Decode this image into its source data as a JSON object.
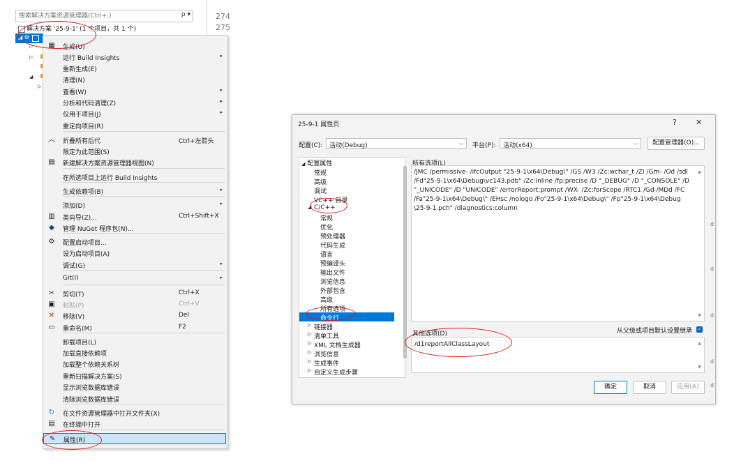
{
  "solution_explorer": {
    "search_placeholder": "搜索解决方案资源管理器(Ctrl+;)",
    "search_button": "ρ ▾",
    "solution_node": "解决方案 '25-9-1' (1 个项目，共 1 个)",
    "project_node": "25-9-1",
    "background_texts": [
      "274",
      "275"
    ]
  },
  "context_menu": {
    "items": [
      {
        "label": "生成(U)",
        "icon": "build-icon",
        "shortcut": "",
        "submenu": false,
        "disabled": false
      },
      {
        "label": "运行 Build Insights",
        "icon": "",
        "shortcut": "",
        "submenu": true,
        "disabled": false
      },
      {
        "label": "重新生成(E)",
        "icon": "",
        "shortcut": "",
        "submenu": false,
        "disabled": false
      },
      {
        "label": "清理(N)",
        "icon": "",
        "shortcut": "",
        "submenu": false,
        "disabled": false
      },
      {
        "label": "查看(W)",
        "icon": "",
        "shortcut": "",
        "submenu": true,
        "disabled": false
      },
      {
        "label": "分析和代码清理(Z)",
        "icon": "",
        "shortcut": "",
        "submenu": true,
        "disabled": false
      },
      {
        "label": "仅用于项目(J)",
        "icon": "",
        "shortcut": "",
        "submenu": true,
        "disabled": false
      },
      {
        "label": "重定向项目(R)",
        "icon": "",
        "shortcut": "",
        "submenu": false,
        "disabled": false
      },
      {
        "label": "折叠所有后代",
        "icon": "collapse-icon",
        "shortcut": "Ctrl+左箭头",
        "submenu": false,
        "disabled": false
      },
      {
        "label": "限定为此范围(S)",
        "icon": "",
        "shortcut": "",
        "submenu": false,
        "disabled": false
      },
      {
        "label": "新建解决方案资源管理器视图(N)",
        "icon": "new-view-icon",
        "shortcut": "",
        "submenu": false,
        "disabled": false
      },
      {
        "label": "在所选项目上运行 Build Insights",
        "icon": "",
        "shortcut": "",
        "submenu": false,
        "disabled": false
      },
      {
        "label": "生成依赖项(B)",
        "icon": "",
        "shortcut": "",
        "submenu": true,
        "disabled": false
      },
      {
        "label": "添加(D)",
        "icon": "",
        "shortcut": "",
        "submenu": true,
        "disabled": false
      },
      {
        "label": "类向导(Z)...",
        "icon": "class-wizard-icon",
        "shortcut": "Ctrl+Shift+X",
        "submenu": false,
        "disabled": false
      },
      {
        "label": "管理 NuGet 程序包(N)...",
        "icon": "nuget-icon",
        "shortcut": "",
        "submenu": false,
        "disabled": false
      },
      {
        "label": "配置启动项目...",
        "icon": "gear-icon",
        "shortcut": "",
        "submenu": false,
        "disabled": false
      },
      {
        "label": "设为启动项目(A)",
        "icon": "",
        "shortcut": "",
        "submenu": false,
        "disabled": false
      },
      {
        "label": "调试(G)",
        "icon": "",
        "shortcut": "",
        "submenu": true,
        "disabled": false
      },
      {
        "label": "Git(I)",
        "icon": "",
        "shortcut": "",
        "submenu": true,
        "disabled": false
      },
      {
        "label": "剪切(T)",
        "icon": "scissors-icon",
        "shortcut": "Ctrl+X",
        "submenu": false,
        "disabled": false
      },
      {
        "label": "粘贴(P)",
        "icon": "paste-icon",
        "shortcut": "Ctrl+V",
        "submenu": false,
        "disabled": true
      },
      {
        "label": "移除(V)",
        "icon": "remove-icon",
        "shortcut": "Del",
        "submenu": false,
        "disabled": false
      },
      {
        "label": "重命名(M)",
        "icon": "rename-icon",
        "shortcut": "F2",
        "submenu": false,
        "disabled": false
      },
      {
        "label": "卸载项目(L)",
        "icon": "",
        "shortcut": "",
        "submenu": false,
        "disabled": false
      },
      {
        "label": "加载直接依赖项",
        "icon": "",
        "shortcut": "",
        "submenu": false,
        "disabled": false
      },
      {
        "label": "加载整个依赖关系树",
        "icon": "",
        "shortcut": "",
        "submenu": false,
        "disabled": false
      },
      {
        "label": "重新扫描解决方案(S)",
        "icon": "",
        "shortcut": "",
        "submenu": false,
        "disabled": false
      },
      {
        "label": "显示浏览数据库错误",
        "icon": "",
        "shortcut": "",
        "submenu": false,
        "disabled": false
      },
      {
        "label": "清除浏览数据库错误",
        "icon": "",
        "shortcut": "",
        "submenu": false,
        "disabled": false
      },
      {
        "label": "在文件资源管理器中打开文件夹(X)",
        "icon": "open-folder-icon",
        "shortcut": "",
        "submenu": false,
        "disabled": false
      },
      {
        "label": "在终端中打开",
        "icon": "terminal-icon",
        "shortcut": "",
        "submenu": false,
        "disabled": false
      },
      {
        "label": "属性(R)",
        "icon": "wrench-icon",
        "shortcut": "",
        "submenu": false,
        "disabled": false,
        "highlighted": true
      }
    ]
  },
  "dialog": {
    "title": "25-9-1 属性页",
    "help_button": "?",
    "close_button": "✕",
    "config_label": "配置(C):",
    "config_value": "活动(Debug)",
    "platform_label": "平台(P):",
    "platform_value": "活动(x64)",
    "config_manager_button": "配置管理器(O)...",
    "tree": {
      "root": "配置属性",
      "items": [
        {
          "label": "常规",
          "level": 1
        },
        {
          "label": "高级",
          "level": 1
        },
        {
          "label": "调试",
          "level": 1
        },
        {
          "label": "VC++ 目录",
          "level": 1
        },
        {
          "label": "C/C++",
          "level": 1,
          "expanded": true
        },
        {
          "label": "常规",
          "level": 2
        },
        {
          "label": "优化",
          "level": 2
        },
        {
          "label": "预处理器",
          "level": 2
        },
        {
          "label": "代码生成",
          "level": 2
        },
        {
          "label": "语言",
          "level": 2
        },
        {
          "label": "预编译头",
          "level": 2
        },
        {
          "label": "输出文件",
          "level": 2
        },
        {
          "label": "浏览信息",
          "level": 2
        },
        {
          "label": "外部包含",
          "level": 2
        },
        {
          "label": "高级",
          "level": 2
        },
        {
          "label": "所有选项",
          "level": 2
        },
        {
          "label": "命令行",
          "level": 2,
          "selected": true
        },
        {
          "label": "链接器",
          "level": 1,
          "collapsed": true
        },
        {
          "label": "清单工具",
          "level": 1,
          "collapsed": true
        },
        {
          "label": "XML 文档生成器",
          "level": 1,
          "collapsed": true
        },
        {
          "label": "浏览信息",
          "level": 1,
          "collapsed": true
        },
        {
          "label": "生成事件",
          "level": 1,
          "collapsed": true
        },
        {
          "label": "自定义生成步骤",
          "level": 1,
          "collapsed": true
        }
      ]
    },
    "all_options_label": "所有选项(L)",
    "all_options_lines": [
      "/JMC /permissive- /ifcOutput \"25-9-1\\x64\\Debug\\\" /GS /W3 /Zc:wchar_t /ZI /Gm- /Od /sdl",
      "/Fd\"25-9-1\\x64\\Debug\\vc143.pdb\" /Zc:inline /fp:precise /D \"_DEBUG\" /D \"_CONSOLE\" /D",
      "\"_UNICODE\" /D \"UNICODE\" /errorReport:prompt /WX- /Zc:forScope /RTC1 /Gd /MDd /FC",
      "/Fa\"25-9-1\\x64\\Debug\\\" /EHsc /nologo /Fo\"25-9-1\\x64\\Debug\\\" /Fp\"25-9-1\\x64\\Debug",
      "\\25-9-1.pch\" /diagnostics:column"
    ],
    "other_options_label": "其他选项(D)",
    "inherit_label": "从父级或项目默认设置继承",
    "inherit_checked": true,
    "other_options_value": "/d1reportAllClassLayout",
    "ok_button": "确定",
    "cancel_button": "取消",
    "apply_button": "应用(A)"
  },
  "colors": {
    "selection": "#0078d7",
    "annotation": "#e01b1b",
    "menu_bg": "#f2f2f2",
    "dialog_bg": "#f3f3f3"
  }
}
